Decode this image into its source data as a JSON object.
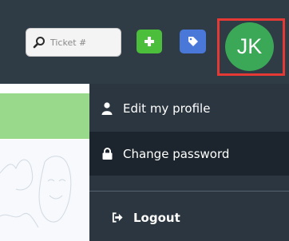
{
  "header": {
    "search": {
      "placeholder": "Ticket #",
      "value": ""
    },
    "add_button": {
      "icon": "plus-icon",
      "color": "#4bbf3b"
    },
    "tag_button": {
      "icon": "tag-icon",
      "color": "#4a78d8"
    },
    "avatar": {
      "initials": "JK",
      "color": "#3aa856",
      "highlight_color": "#e53935"
    }
  },
  "user_menu": {
    "items": [
      {
        "label": "Edit my profile",
        "icon": "user-icon"
      },
      {
        "label": "Change password",
        "icon": "lock-icon"
      },
      {
        "label": "Logout",
        "icon": "sign-out-icon"
      }
    ]
  }
}
